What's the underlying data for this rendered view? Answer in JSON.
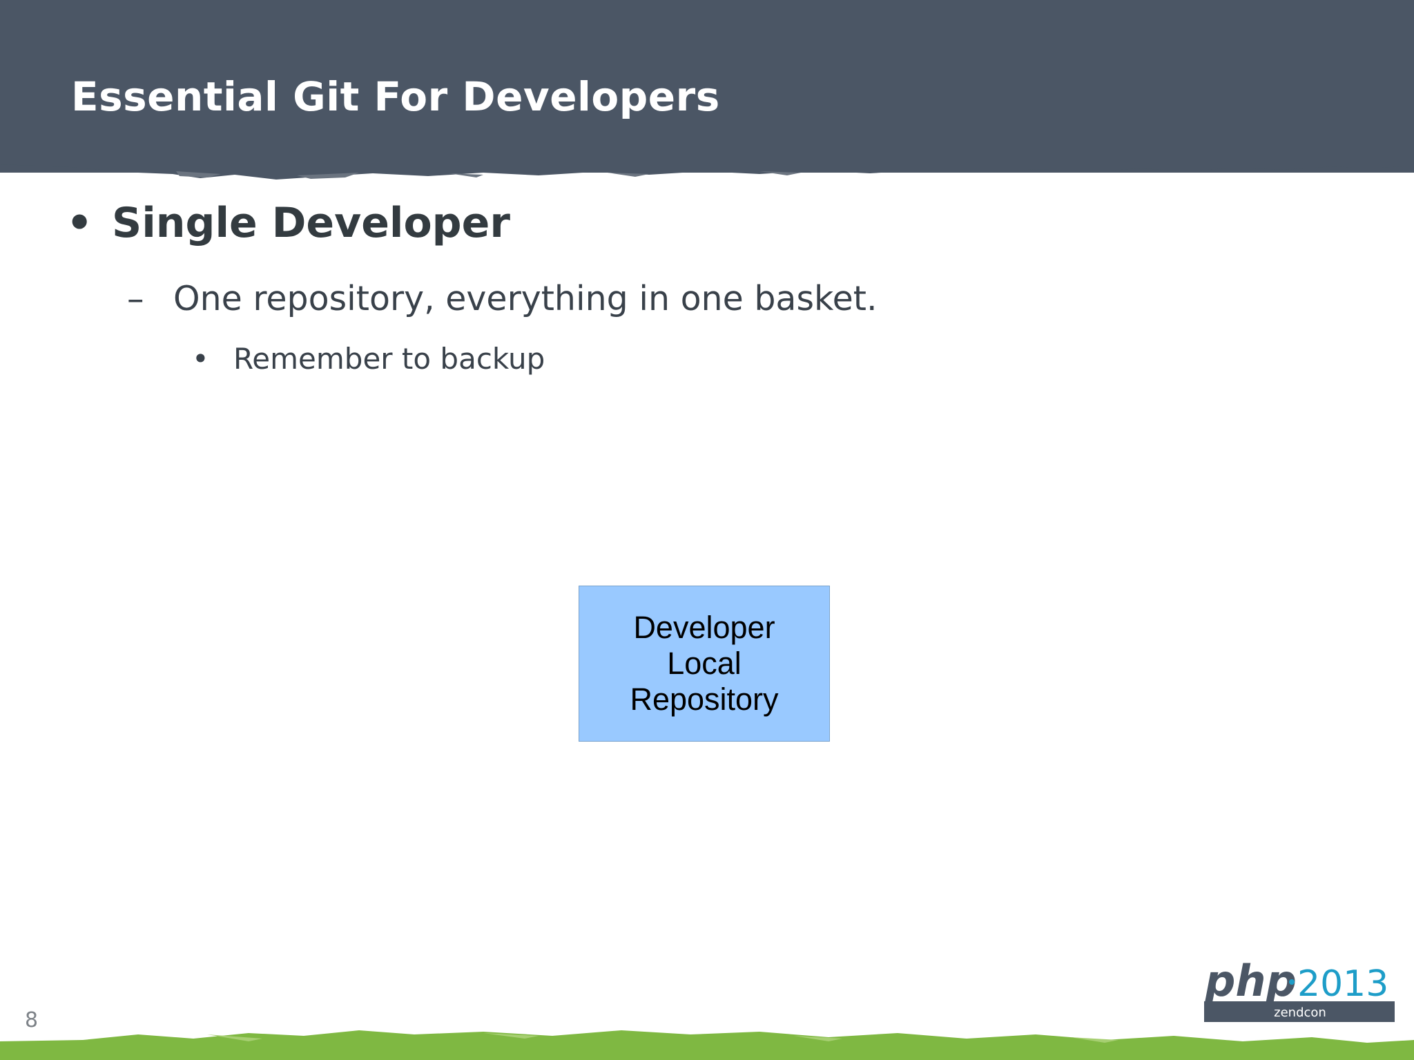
{
  "slide": {
    "title": "Essential Git For Developers",
    "page_number": "8"
  },
  "bullets": {
    "level1": {
      "marker": "•",
      "text": "Single Developer"
    },
    "level2": {
      "marker": "–",
      "text": "One repository, everything in one basket."
    },
    "level3": {
      "marker": "•",
      "text": "Remember to backup"
    }
  },
  "diagram": {
    "box_lines": [
      "Developer",
      "Local",
      "Repository"
    ],
    "box_color": "#99c9ff"
  },
  "logo": {
    "php": "php",
    "year": "2013",
    "sub": "zendcon"
  },
  "colors": {
    "header": "#4b5665",
    "footer": "#7fb842",
    "logo_accent": "#1d9dc8"
  }
}
